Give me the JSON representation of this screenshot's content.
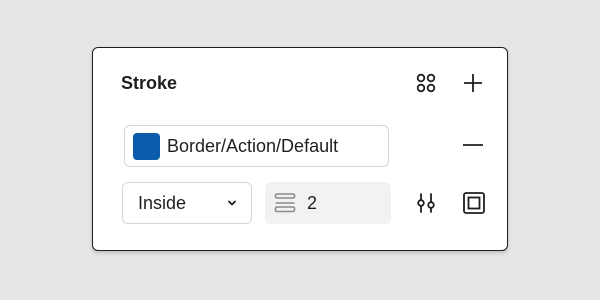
{
  "panel": {
    "title": "Stroke",
    "icons": {
      "styles": "four-dots-icon",
      "add": "plus-icon",
      "remove": "minus-icon",
      "advanced": "sliders-icon",
      "frame": "frame-icon",
      "weight": "stroke-weight-icon",
      "dropdown": "chevron-down-icon"
    },
    "color": {
      "swatch": "#0b5cab",
      "name": "Border/Action/Default"
    },
    "position": {
      "selected": "Inside"
    },
    "weight": {
      "value": "2"
    }
  }
}
